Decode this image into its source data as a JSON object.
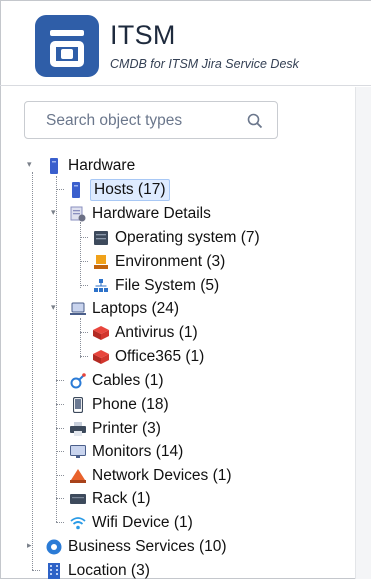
{
  "header": {
    "title": "ITSM",
    "subtitle": "CMDB for ITSM Jira Service Desk"
  },
  "search": {
    "placeholder": "Search object types"
  },
  "tree": {
    "hardware": "Hardware",
    "hosts": "Hosts (17)",
    "hardware_details": "Hardware Details",
    "operating_system": "Operating system (7)",
    "environment": "Environment (3)",
    "file_system": "File System (5)",
    "laptops": "Laptops (24)",
    "antivirus": "Antivirus (1)",
    "office365": "Office365 (1)",
    "cables": "Cables (1)",
    "phone": "Phone (18)",
    "printer": "Printer (3)",
    "monitors": "Monitors (14)",
    "network_devices": "Network Devices (1)",
    "rack": "Rack (1)",
    "wifi_device": "Wifi Device (1)",
    "business_services": "Business Services (10)",
    "location": "Location (3)"
  },
  "colors": {
    "brand": "#2f5ea8",
    "selection": "#deebff"
  }
}
